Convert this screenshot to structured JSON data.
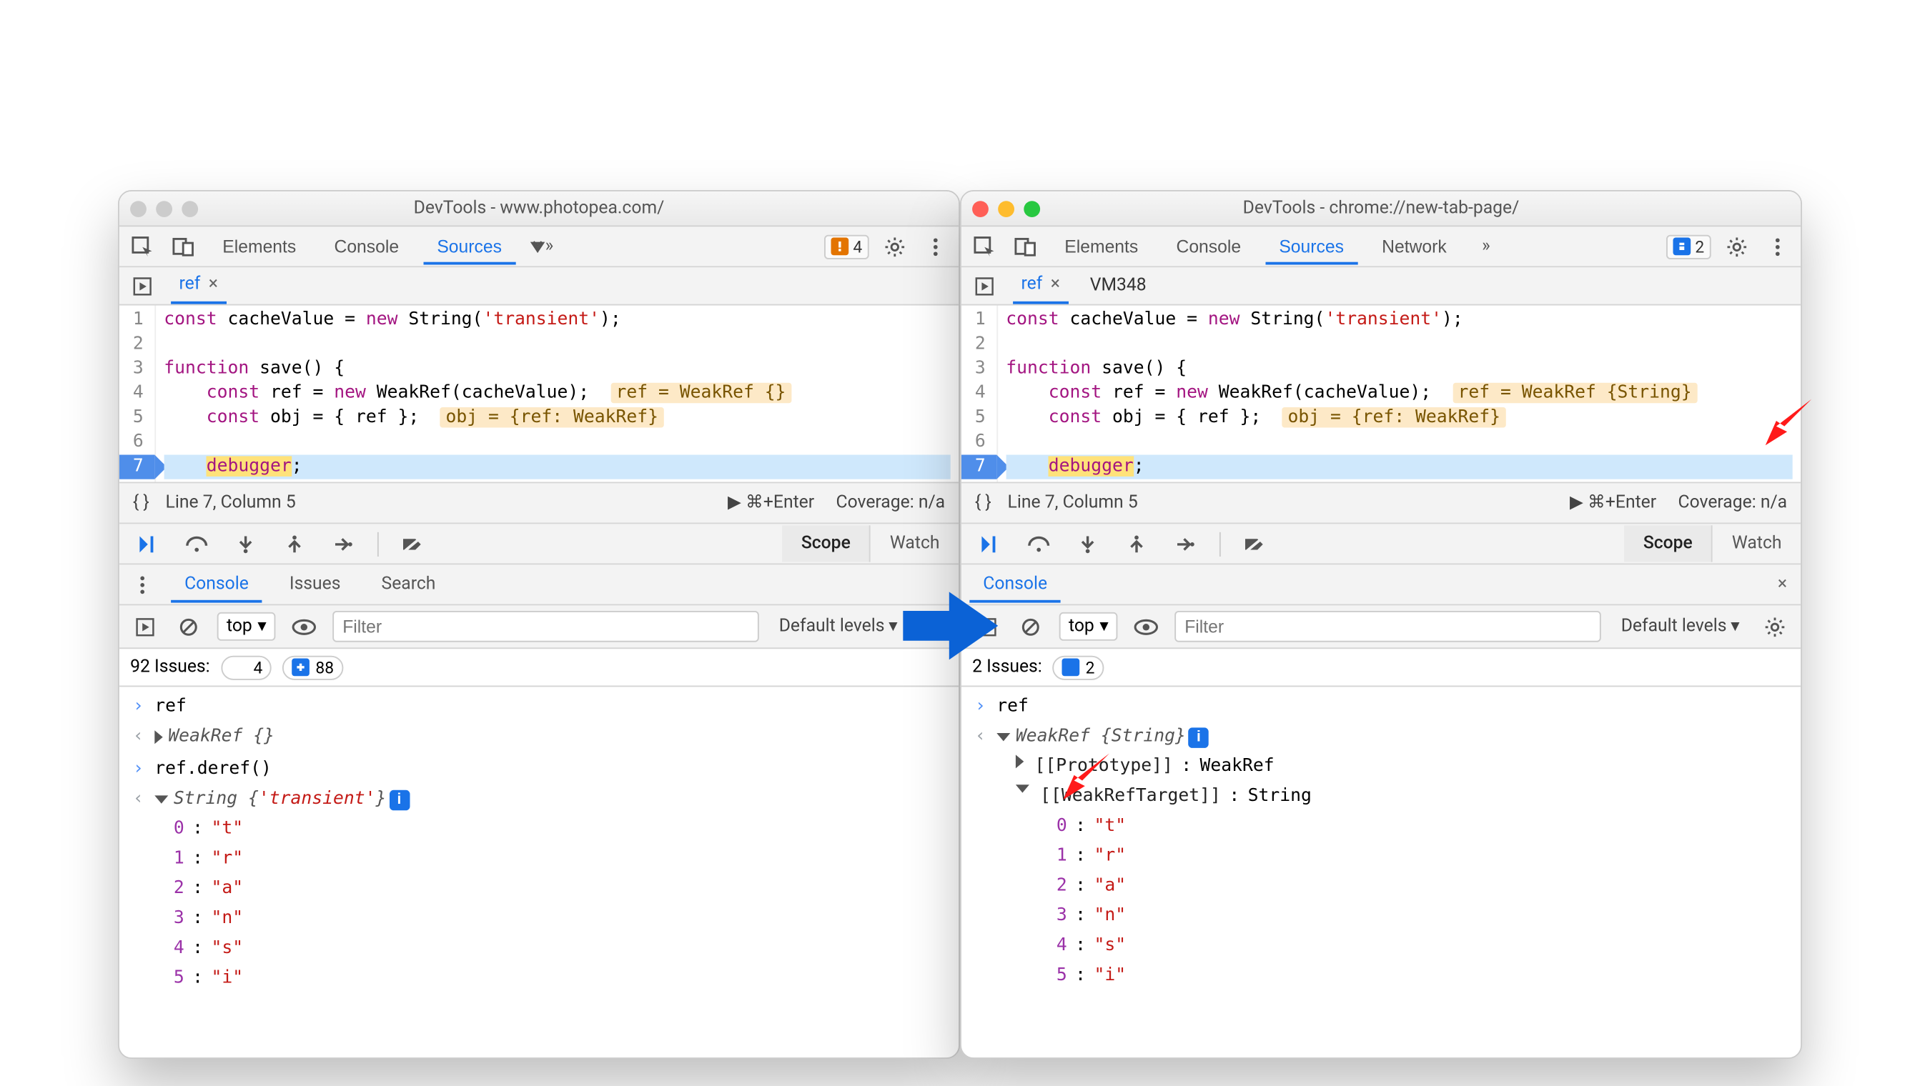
{
  "left": {
    "title": "DevTools - www.photopea.com/",
    "tabs": {
      "elements": "Elements",
      "console": "Console",
      "sources": "Sources"
    },
    "topBadge": {
      "kind": "warn",
      "count": "4"
    },
    "files": {
      "ref": "ref"
    },
    "code": {
      "l1a": "const",
      "l1b": " cacheValue = ",
      "l1c": "new",
      "l1d": " String(",
      "l1e": "'transient'",
      "l1f": ");",
      "l3a": "function",
      "l3b": " save() {",
      "l4a": "const",
      "l4b": " ref = ",
      "l4c": "new",
      "l4d": " WeakRef(cacheValue);  ",
      "l4hint": "ref = WeakRef {}",
      "l5a": "const",
      "l5b": " obj = { ref };  ",
      "l5hint": "obj = {ref: WeakRef}",
      "l7a": "debugger",
      "l7b": ";"
    },
    "status": {
      "pos": "Line 7, Column 5",
      "run": "⌘+Enter",
      "coverage": "Coverage: n/a"
    },
    "scope": "Scope",
    "watch": "Watch",
    "drawerTabs": {
      "console": "Console",
      "issues": "Issues",
      "search": "Search"
    },
    "console": {
      "ctx": "top",
      "filterPlaceholder": "Filter",
      "levels": "Default levels",
      "issuesLabel": "92 Issues:",
      "issuesWarn": "4",
      "issuesInfo": "88",
      "in1": "ref",
      "out1": "WeakRef {}",
      "in2": "ref.deref()",
      "out2pre": "String {",
      "out2str": "'transient'",
      "out2post": "}",
      "chars": {
        "k0": "0",
        "v0": "\"t\"",
        "k1": "1",
        "v1": "\"r\"",
        "k2": "2",
        "v2": "\"a\"",
        "k3": "3",
        "v3": "\"n\"",
        "k4": "4",
        "v4": "\"s\"",
        "k5": "5",
        "v5": "\"i\""
      }
    }
  },
  "right": {
    "title": "DevTools - chrome://new-tab-page/",
    "tabs": {
      "elements": "Elements",
      "console": "Console",
      "sources": "Sources",
      "network": "Network"
    },
    "topBadge": {
      "kind": "info",
      "count": "2"
    },
    "files": {
      "ref": "ref",
      "vm": "VM348"
    },
    "code": {
      "l1a": "const",
      "l1b": " cacheValue = ",
      "l1c": "new",
      "l1d": " String(",
      "l1e": "'transient'",
      "l1f": ");",
      "l3a": "function",
      "l3b": " save() {",
      "l4a": "const",
      "l4b": " ref = ",
      "l4c": "new",
      "l4d": " WeakRef(cacheValue);  ",
      "l4hint": "ref = WeakRef {String}",
      "l5a": "const",
      "l5b": " obj = { ref };  ",
      "l5hint": "obj = {ref: WeakRef}",
      "l7a": "debugger",
      "l7b": ";"
    },
    "status": {
      "pos": "Line 7, Column 5",
      "run": "⌘+Enter",
      "coverage": "Coverage: n/a"
    },
    "scope": "Scope",
    "watch": "Watch",
    "drawerTabs": {
      "console": "Console"
    },
    "console": {
      "ctx": "top",
      "filterPlaceholder": "Filter",
      "levels": "Default levels",
      "issuesLabel": "2 Issues:",
      "issuesInfo": "2",
      "in1": "ref",
      "out1": "WeakRef {String}",
      "proto": "[[Prototype]]",
      "protoVal": "WeakRef",
      "target": "[[WeakRefTarget]]",
      "targetVal": "String",
      "chars": {
        "k0": "0",
        "v0": "\"t\"",
        "k1": "1",
        "v1": "\"r\"",
        "k2": "2",
        "v2": "\"a\"",
        "k3": "3",
        "v3": "\"n\"",
        "k4": "4",
        "v4": "\"s\"",
        "k5": "5",
        "v5": "\"i\""
      }
    }
  }
}
